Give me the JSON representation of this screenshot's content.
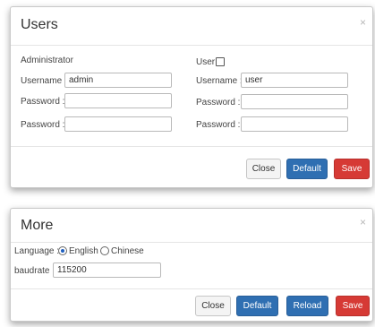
{
  "users_dialog": {
    "title": "Users",
    "close_glyph": "×",
    "administrator": {
      "heading": "Administrator",
      "username_label": "Username :",
      "username_value": "admin",
      "password_label": "Password :",
      "password_value": "",
      "confirm_label": "Password :",
      "confirm_value": ""
    },
    "user": {
      "heading": "User",
      "enabled": false,
      "username_label": "Username :",
      "username_value": "user",
      "password_label": "Password :",
      "password_value": "",
      "confirm_label": "Password :",
      "confirm_value": ""
    },
    "buttons": {
      "close": "Close",
      "default": "Default",
      "save": "Save"
    }
  },
  "more_dialog": {
    "title": "More",
    "close_glyph": "×",
    "language_label": "Language :",
    "language_options": [
      "English",
      "Chinese"
    ],
    "language_selected": "English",
    "baudrate_label": "baudrate :",
    "baudrate_value": "115200",
    "buttons": {
      "close": "Close",
      "default": "Default",
      "reload": "Reload",
      "save": "Save"
    }
  },
  "colors": {
    "primary": "#2f6fb2",
    "danger": "#d63a35",
    "close_button": "#f4f4f4"
  }
}
